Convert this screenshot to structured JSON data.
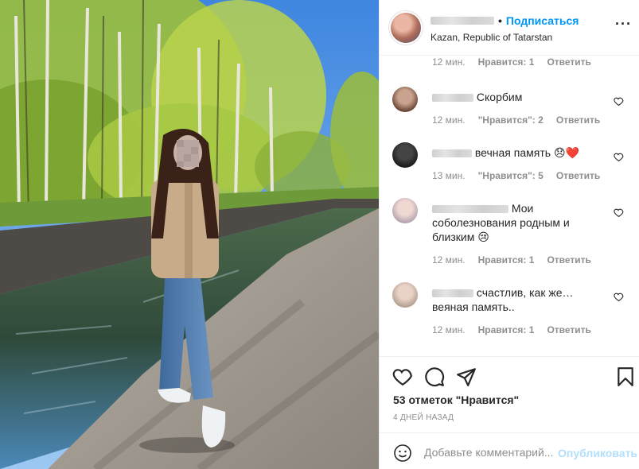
{
  "post": {
    "username_hidden": true,
    "dot": "•",
    "follow_label": "Подписаться",
    "location": "Kazan, Republic of Tatarstan",
    "more_icon": "more-horizontal-icon"
  },
  "comments": [
    {
      "text": "",
      "time": "12 мин.",
      "likes": "Нравится: 1",
      "reply": "Ответить"
    },
    {
      "text": "Скорбим",
      "time": "12 мин.",
      "likes": "\"Нравится\": 2",
      "reply": "Ответить"
    },
    {
      "text": "вечная память 😞❤️",
      "time": "13 мин.",
      "likes": "\"Нравится\": 5",
      "reply": "Ответить"
    },
    {
      "text": "Мои соболезнования родным и близким 😢",
      "time": "12 мин.",
      "likes": "Нравится: 1",
      "reply": "Ответить"
    },
    {
      "text": "счастлив, как же… веяная память..",
      "time": "12 мин.",
      "likes": "Нравится: 1",
      "reply": "Ответить"
    }
  ],
  "actions": {
    "icons": [
      "heart-icon",
      "comment-icon",
      "share-icon",
      "bookmark-icon"
    ],
    "likes_text": "53 отметок \"Нравится\"",
    "time_ago": "4 ДНЕЙ НАЗАД"
  },
  "composer": {
    "placeholder": "Добавьте комментарий...",
    "publish_label": "Опубликовать"
  },
  "colors": {
    "accent": "#0095f6",
    "publish_disabled": "#b2dffc",
    "muted": "#8e8e8e"
  }
}
